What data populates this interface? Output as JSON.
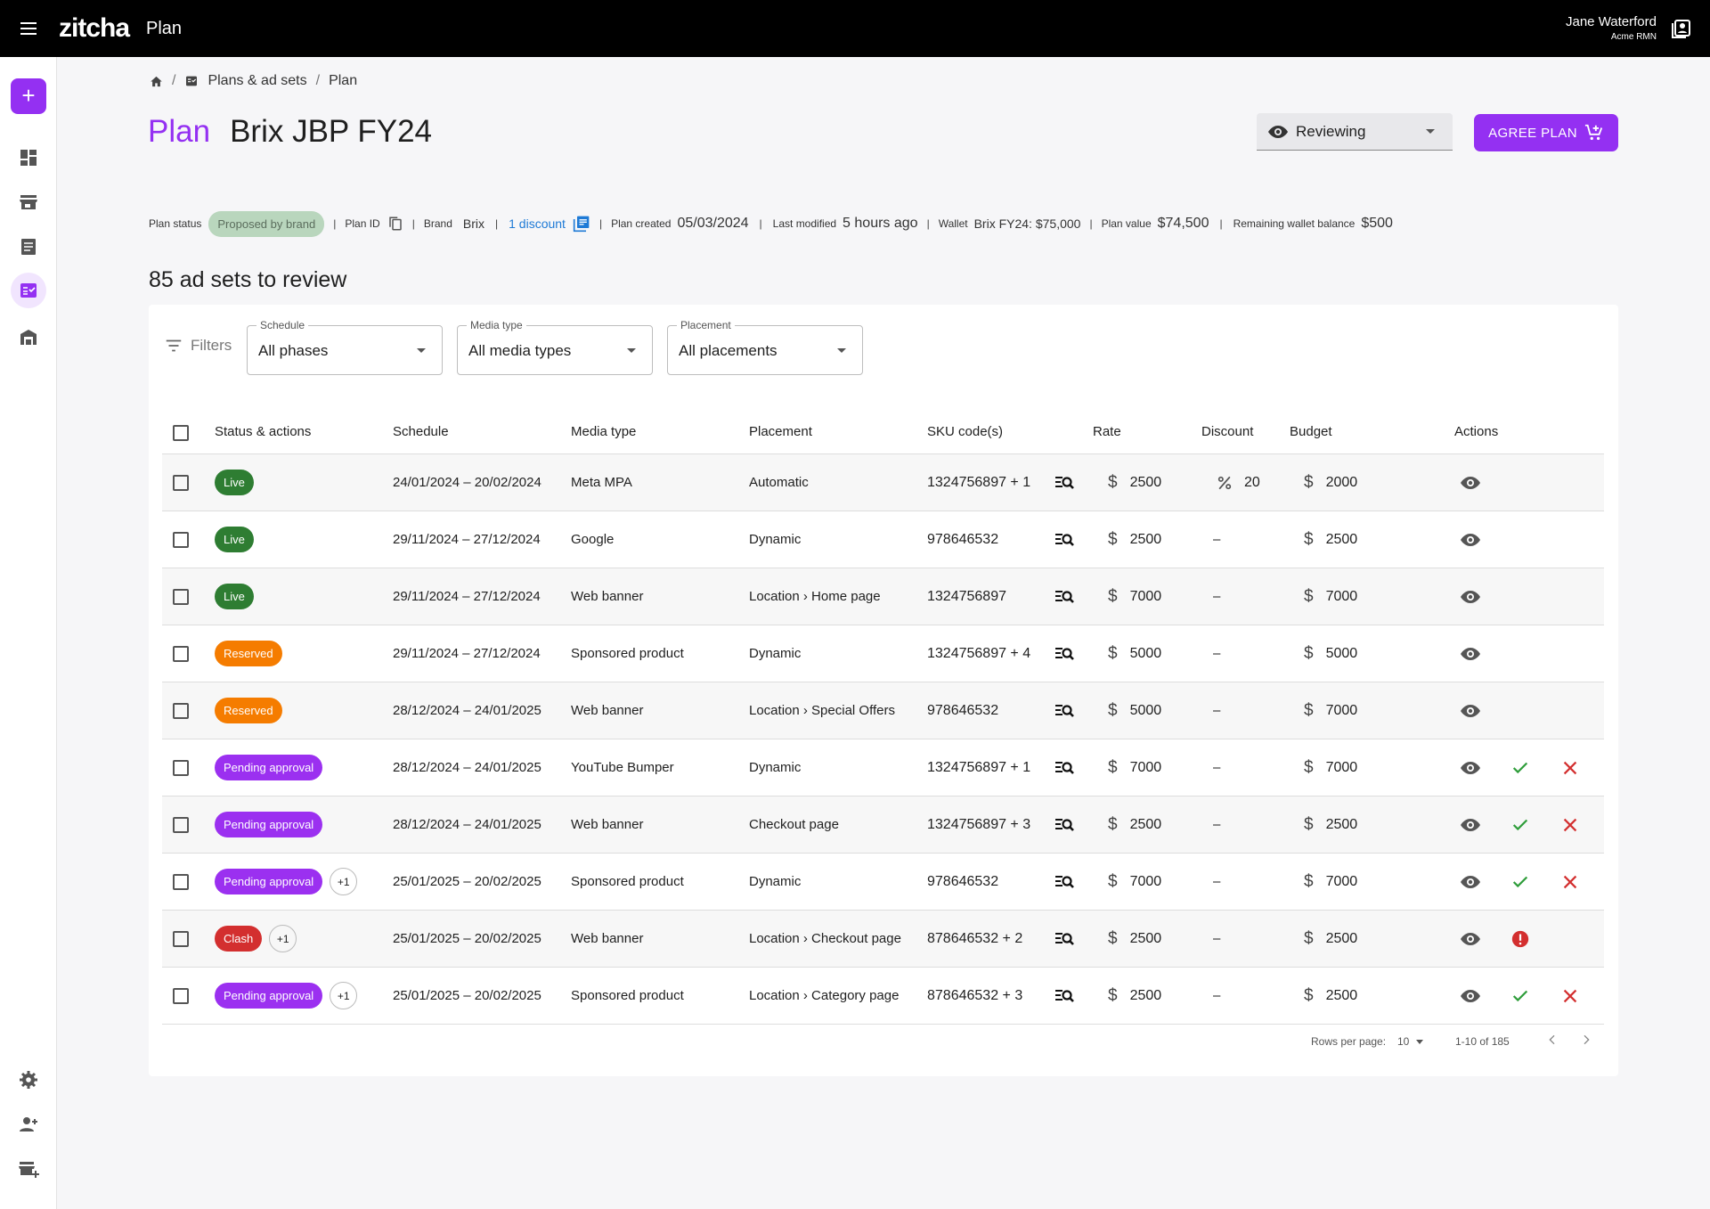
{
  "header": {
    "logo": "zitcha",
    "app": "Plan",
    "user_name": "Jane Waterford",
    "org": "Acme RMN"
  },
  "sidebar": {
    "add_label": "+",
    "items": [
      "dashboard-icon",
      "store-icon",
      "list-icon",
      "plans-icon",
      "warehouse-icon",
      "settings-icon",
      "add-user-icon",
      "add-store-icon"
    ]
  },
  "breadcrumb": {
    "items": [
      "Plans & ad sets",
      "Plan"
    ],
    "sep": "/"
  },
  "title": {
    "prefix": "Plan",
    "name": "Brix JBP FY24"
  },
  "status_select": {
    "value": "Reviewing"
  },
  "agree_button": {
    "label": "AGREE PLAN"
  },
  "meta": {
    "status_label": "Plan status",
    "status_value": "Proposed by brand",
    "plan_id_label": "Plan ID",
    "brand_label": "Brand",
    "brand_value": "Brix",
    "discount_link": "1 discount",
    "created_label": "Plan created",
    "created_value": "05/03/2024",
    "modified_label": "Last modified",
    "modified_value": "5 hours ago",
    "wallet_label": "Wallet",
    "wallet_value": "Brix FY24: $75,000",
    "value_label": "Plan value",
    "value_value": "$74,500",
    "remaining_label": "Remaining wallet balance",
    "remaining_value": "$500",
    "sep": "|"
  },
  "subtitle": "85 ad sets to review",
  "filters": {
    "label": "Filters",
    "schedule": {
      "label": "Schedule",
      "value": "All phases"
    },
    "media": {
      "label": "Media type",
      "value": "All media types"
    },
    "placement": {
      "label": "Placement",
      "value": "All placements"
    }
  },
  "table": {
    "headers": {
      "status": "Status & actions",
      "schedule": "Schedule",
      "media": "Media type",
      "placement": "Placement",
      "sku": "SKU code(s)",
      "rate": "Rate",
      "discount": "Discount",
      "budget": "Budget",
      "actions": "Actions"
    },
    "currency": "$",
    "rows": [
      {
        "status": "Live",
        "kind": "live",
        "plus": "",
        "schedule": "24/01/2024 – 20/02/2024",
        "media": "Meta MPA",
        "placement": "Automatic",
        "sku": "1324756897 + 1",
        "rate": "2500",
        "discount": "20",
        "budget": "2000",
        "approve": false,
        "clash": false
      },
      {
        "status": "Live",
        "kind": "live",
        "plus": "",
        "schedule": "29/11/2024 – 27/12/2024",
        "media": "Google",
        "placement": "Dynamic",
        "sku": "978646532",
        "rate": "2500",
        "discount": "–",
        "budget": "2500",
        "approve": false,
        "clash": false
      },
      {
        "status": "Live",
        "kind": "live",
        "plus": "",
        "schedule": "29/11/2024 – 27/12/2024",
        "media": "Web banner",
        "placement": "Location › Home page",
        "sku": "1324756897",
        "rate": "7000",
        "discount": "–",
        "budget": "7000",
        "approve": false,
        "clash": false
      },
      {
        "status": "Reserved",
        "kind": "res",
        "plus": "",
        "schedule": "29/11/2024 – 27/12/2024",
        "media": "Sponsored product",
        "placement": "Dynamic",
        "sku": "1324756897 + 4",
        "rate": "5000",
        "discount": "–",
        "budget": "5000",
        "approve": false,
        "clash": false
      },
      {
        "status": "Reserved",
        "kind": "res",
        "plus": "",
        "schedule": "28/12/2024 – 24/01/2025",
        "media": "Web banner",
        "placement": "Location › Special Offers",
        "sku": "978646532",
        "rate": "5000",
        "discount": "–",
        "budget": "7000",
        "approve": false,
        "clash": false
      },
      {
        "status": "Pending approval",
        "kind": "pen",
        "plus": "",
        "schedule": "28/12/2024 – 24/01/2025",
        "media": "YouTube Bumper",
        "placement": "Dynamic",
        "sku": "1324756897 + 1",
        "rate": "7000",
        "discount": "–",
        "budget": "7000",
        "approve": true,
        "clash": false
      },
      {
        "status": "Pending approval",
        "kind": "pen",
        "plus": "",
        "schedule": "28/12/2024 – 24/01/2025",
        "media": "Web banner",
        "placement": "Checkout page",
        "sku": "1324756897 + 3",
        "rate": "2500",
        "discount": "–",
        "budget": "2500",
        "approve": true,
        "clash": false
      },
      {
        "status": "Pending approval",
        "kind": "pen",
        "plus": "+1",
        "schedule": "25/01/2025 – 20/02/2025",
        "media": "Sponsored product",
        "placement": "Dynamic",
        "sku": "978646532",
        "rate": "7000",
        "discount": "–",
        "budget": "7000",
        "approve": true,
        "clash": false
      },
      {
        "status": "Clash",
        "kind": "cla",
        "plus": "+1",
        "schedule": "25/01/2025 – 20/02/2025",
        "media": "Web banner",
        "placement": "Location › Checkout page",
        "sku": "878646532 + 2",
        "rate": "2500",
        "discount": "–",
        "budget": "2500",
        "approve": false,
        "clash": true
      },
      {
        "status": "Pending approval",
        "kind": "pen",
        "plus": "+1",
        "schedule": "25/01/2025 – 20/02/2025",
        "media": "Sponsored product",
        "placement": "Location › Category page",
        "sku": "878646532 + 3",
        "rate": "2500",
        "discount": "–",
        "budget": "2500",
        "approve": true,
        "clash": false
      }
    ]
  },
  "pagination": {
    "rows_label": "Rows per page:",
    "rows_value": "10",
    "range": "1-10 of 185"
  },
  "colors": {
    "accent": "#9430f2",
    "live": "#2e7d32",
    "reserved": "#f57c00",
    "clash": "#d32f2f",
    "link": "#1e7ad6"
  }
}
